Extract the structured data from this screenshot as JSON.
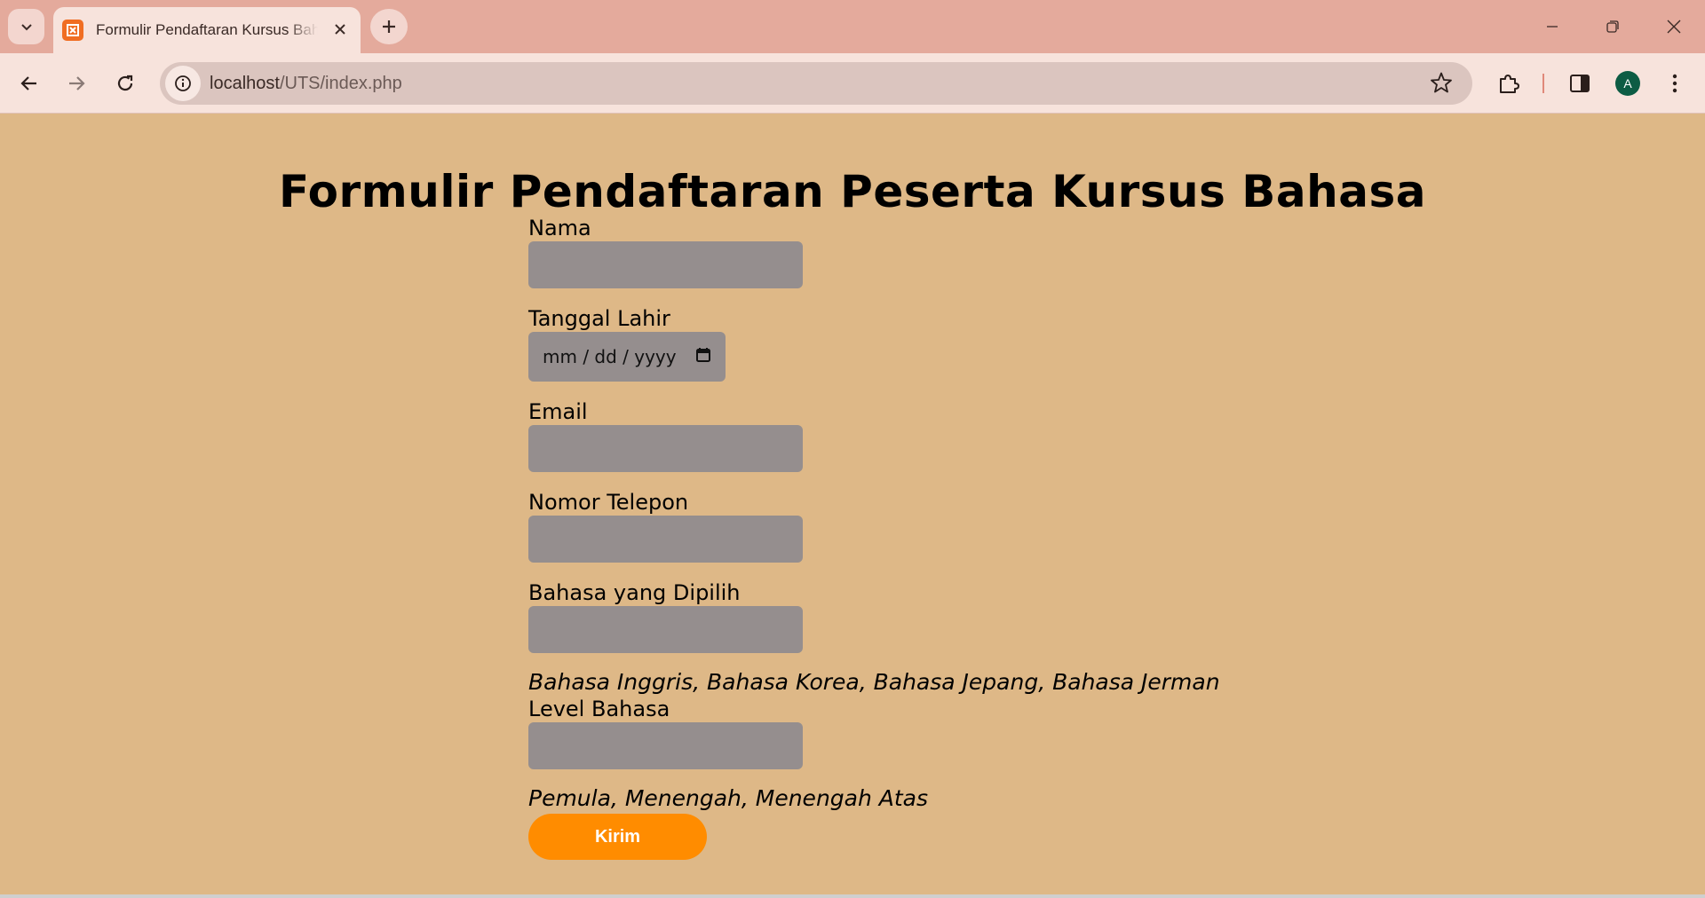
{
  "browser": {
    "tab_title": "Formulir Pendaftaran Kursus Bahasa",
    "url_host": "localhost",
    "url_path": "/UTS/index.php",
    "profile_initial": "A",
    "accent_color": "#f06d22"
  },
  "page": {
    "title": "Formulir Pendaftaran Peserta Kursus Bahasa",
    "background_color": "#deb887",
    "form": {
      "nama_label": "Nama",
      "tanggal_label": "Tanggal Lahir",
      "tanggal_placeholder": "mm / dd / yyyy",
      "email_label": "Email",
      "telepon_label": "Nomor Telepon",
      "bahasa_label": "Bahasa yang Dipilih",
      "bahasa_hint": "Bahasa Inggris, Bahasa Korea, Bahasa Jepang, Bahasa Jerman",
      "level_label": "Level Bahasa",
      "level_hint": "Pemula, Menengah, Menengah Atas",
      "submit_label": "Kirim",
      "submit_color": "#ff8c00"
    }
  },
  "icons": [
    "tab-search-icon",
    "app-favicon-icon",
    "close-tab-icon",
    "new-tab-icon",
    "minimize-icon",
    "restore-icon",
    "close-window-icon",
    "back-icon",
    "forward-icon",
    "reload-icon",
    "site-info-icon",
    "bookmark-star-icon",
    "extensions-icon",
    "side-panel-icon",
    "menu-icon",
    "calendar-icon"
  ]
}
